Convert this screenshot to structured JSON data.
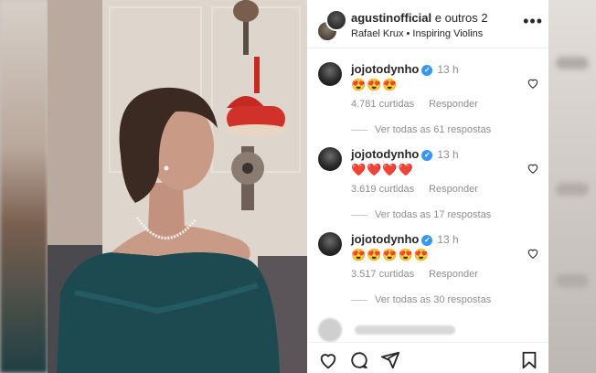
{
  "post": {
    "header": {
      "username": "agustinofficial",
      "collab_suffix": "e outros 2",
      "audio": "Rafael Krux • Inspiring Violins",
      "more_icon": "more-horizontal-icon"
    },
    "comments": [
      {
        "username": "jojotodynho",
        "time": "13 h",
        "text": "😍😍😍",
        "likes": "4.781 curtidas",
        "reply": "Responder",
        "replies": "Ver todas as 61 respostas"
      },
      {
        "username": "jojotodynho",
        "time": "13 h",
        "text": "❤️❤️❤️❤️",
        "likes": "3.619 curtidas",
        "reply": "Responder",
        "replies": "Ver todas as 17 respostas"
      },
      {
        "username": "jojotodynho",
        "time": "13 h",
        "text": "😍😍😍😍😍",
        "likes": "3.517 curtidas",
        "reply": "Responder",
        "replies": "Ver todas as 30 respostas"
      }
    ],
    "actions": {
      "like_icon": "heart-icon",
      "comment_icon": "comment-icon",
      "share_icon": "share-icon",
      "save_icon": "bookmark-icon"
    }
  }
}
